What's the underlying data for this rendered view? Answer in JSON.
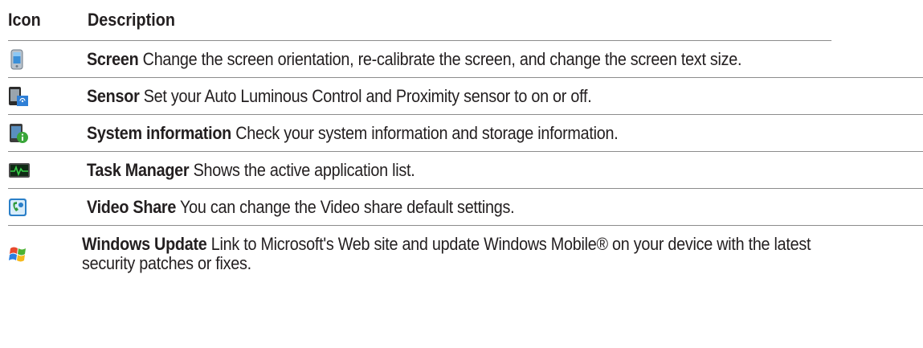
{
  "header": {
    "icon_col": "Icon",
    "desc_col": "Description"
  },
  "rows": [
    {
      "icon": "screen-icon",
      "name": "Screen",
      "text": "Change the screen orientation, re-calibrate the screen, and change the screen text size."
    },
    {
      "icon": "sensor-icon",
      "name": "Sensor",
      "text": "Set your Auto Luminous Control and Proximity sensor to on or off."
    },
    {
      "icon": "system-information-icon",
      "name": "System information",
      "text": "Check your system information and storage information."
    },
    {
      "icon": "task-manager-icon",
      "name": "Task Manager",
      "text": "Shows the active application list."
    },
    {
      "icon": "video-share-icon",
      "name": "Video Share",
      "text": "You can change the Video share default settings."
    },
    {
      "icon": "windows-update-icon",
      "name": "Windows Update",
      "text": "Link to Microsoft's Web site and update Windows Mobile® on your device with the latest security patches or fixes."
    }
  ]
}
